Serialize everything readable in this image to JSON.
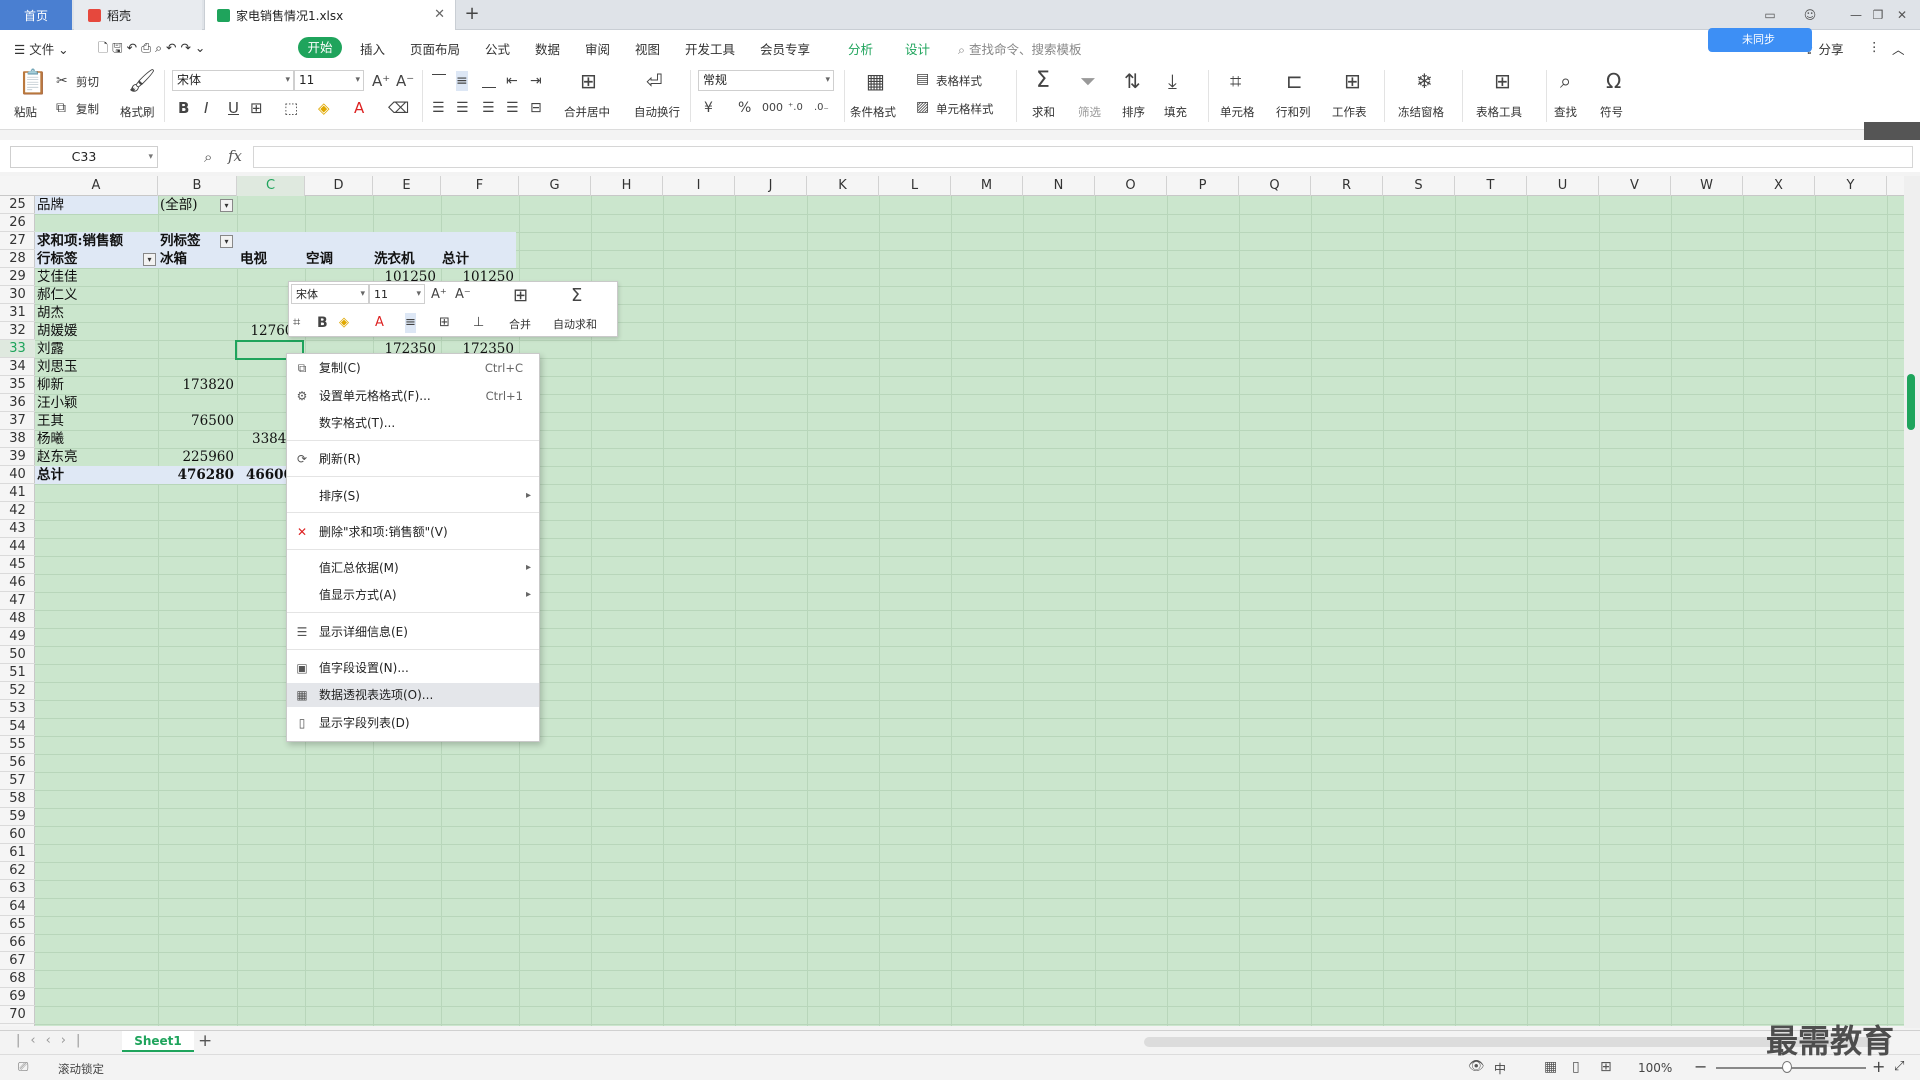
{
  "tabs": {
    "home": "首页",
    "daoke": "稻壳",
    "file": "家电销售情况1.xlsx"
  },
  "menubar": {
    "file": "文件",
    "items": [
      "开始",
      "插入",
      "页面布局",
      "公式",
      "数据",
      "审阅",
      "视图",
      "开发工具",
      "会员专享"
    ],
    "green_items": [
      "分析",
      "设计"
    ],
    "search": "查找命令、搜索模板",
    "cloud": "未同步",
    "share": "分享"
  },
  "ribbon": {
    "paste": "粘贴",
    "cut": "剪切",
    "copy": "复制",
    "format_painter": "格式刷",
    "font_name": "宋体",
    "font_size": "11",
    "merge_center": "合并居中",
    "wrap": "自动换行",
    "number_format": "常规",
    "cond_format": "条件格式",
    "table_style": "表格样式",
    "cell_style": "单元格样式",
    "sum": "求和",
    "filter": "筛选",
    "sort": "排序",
    "fill": "填充",
    "cell": "单元格",
    "rowcol": "行和列",
    "worksheet": "工作表",
    "freeze": "冻结窗格",
    "table_tools": "表格工具",
    "find": "查找",
    "symbol": "符号"
  },
  "formula_bar": {
    "cell_ref": "C33",
    "fx": "fx",
    "content": ""
  },
  "columns": [
    "A",
    "B",
    "C",
    "D",
    "E",
    "F",
    "G",
    "H",
    "I",
    "J",
    "K",
    "L",
    "M",
    "N",
    "O",
    "P",
    "Q",
    "R",
    "S",
    "T",
    "U",
    "V",
    "W",
    "X",
    "Y"
  ],
  "rows": [
    "25",
    "26",
    "27",
    "28",
    "29",
    "30",
    "31",
    "32",
    "33",
    "34",
    "35",
    "36",
    "37",
    "38",
    "39",
    "40",
    "41",
    "42",
    "43",
    "44",
    "45",
    "46",
    "47",
    "48",
    "49",
    "50",
    "51",
    "52",
    "53",
    "54",
    "55",
    "56",
    "57",
    "58",
    "59",
    "60",
    "61",
    "62",
    "63",
    "64",
    "65",
    "66",
    "67",
    "68",
    "69",
    "70"
  ],
  "pivot": {
    "filter_label": "品牌",
    "filter_value": "(全部)",
    "sum_label": "求和项:销售额",
    "col_label": "列标签",
    "row_label": "行标签",
    "headers": [
      "冰箱",
      "电视",
      "空调",
      "洗衣机",
      "总计"
    ],
    "names": [
      "艾佳佳",
      "郝仁义",
      "胡杰",
      "胡媛媛",
      "刘露",
      "刘思玉",
      "柳新",
      "汪小颖",
      "王其",
      "杨曦",
      "赵东亮"
    ],
    "total_label": "总计",
    "visible_values": {
      "e29": "101250",
      "f29": "101250",
      "c32": "127600",
      "e33": "172350",
      "f33": "172350",
      "b35": "173820",
      "b37": "76500",
      "c38": "3384",
      "b39": "225960",
      "b40": "476280",
      "c40": "46600"
    }
  },
  "minibar": {
    "font": "宋体",
    "size": "11",
    "merge": "合并",
    "autosum": "自动求和"
  },
  "context_menu": [
    {
      "label": "复制(C)",
      "shortcut": "Ctrl+C",
      "icon": "copy-icon"
    },
    {
      "label": "设置单元格格式(F)...",
      "shortcut": "Ctrl+1",
      "icon": "format-cells-icon"
    },
    {
      "label": "数字格式(T)...",
      "shortcut": "",
      "icon": ""
    },
    {
      "label": "刷新(R)",
      "shortcut": "",
      "icon": "refresh-icon"
    },
    {
      "label": "排序(S)",
      "shortcut": "",
      "icon": "",
      "submenu": true
    },
    {
      "label": "删除\"求和项:销售额\"(V)",
      "shortcut": "",
      "icon": "delete-icon"
    },
    {
      "label": "值汇总依据(M)",
      "shortcut": "",
      "icon": "",
      "submenu": true
    },
    {
      "label": "值显示方式(A)",
      "shortcut": "",
      "icon": "",
      "submenu": true
    },
    {
      "label": "显示详细信息(E)",
      "shortcut": "",
      "icon": "details-icon"
    },
    {
      "label": "值字段设置(N)...",
      "shortcut": "",
      "icon": "field-settings-icon"
    },
    {
      "label": "数据透视表选项(O)...",
      "shortcut": "",
      "icon": "pivot-options-icon"
    },
    {
      "label": "显示字段列表(D)",
      "shortcut": "",
      "icon": "field-list-icon"
    }
  ],
  "sheet": {
    "name": "Sheet1"
  },
  "status": {
    "scroll_lock": "滚动锁定",
    "zoom": "100%",
    "ime": "中"
  },
  "watermark": "最需教育",
  "colors": {
    "accent": "#1fa45c",
    "grid_bg": "#cbe6cd",
    "tab_active": "#4a7fd1"
  }
}
